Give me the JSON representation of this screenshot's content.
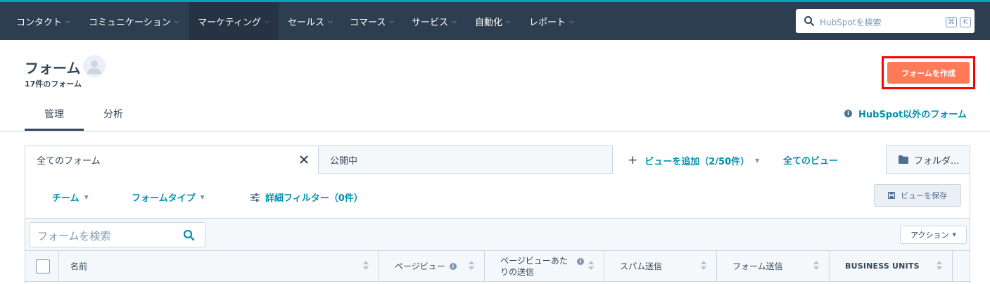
{
  "nav": {
    "items": [
      {
        "label": "コンタクト"
      },
      {
        "label": "コミュニケーション"
      },
      {
        "label": "マーケティング",
        "active": true
      },
      {
        "label": "セールス"
      },
      {
        "label": "コマース"
      },
      {
        "label": "サービス"
      },
      {
        "label": "自動化"
      },
      {
        "label": "レポート"
      }
    ],
    "search_placeholder": "HubSpotを検索",
    "shortcut_keys": [
      "⌘",
      "K"
    ]
  },
  "header": {
    "title": "フォーム",
    "subtitle": "17件のフォーム",
    "create_button": "フォームを作成",
    "highlight_color": "#ff0000",
    "accent_color": "#ff7a59"
  },
  "tabs": {
    "items": [
      {
        "label": "管理",
        "active": true
      },
      {
        "label": "分析"
      }
    ],
    "non_hubspot_link": "HubSpot以外のフォーム"
  },
  "views": {
    "tabs": [
      {
        "label": "全てのフォーム",
        "active": true,
        "closable": true
      },
      {
        "label": "公開中"
      }
    ],
    "add_view": "ビューを追加（2/50件）",
    "all_views": "全てのビュー",
    "folders": "フォルダ..."
  },
  "filters": {
    "team": "チーム",
    "form_type": "フォームタイプ",
    "advanced": "詳細フィルター（0件）",
    "save_view": "ビューを保存"
  },
  "toolbar": {
    "search_placeholder": "フォームを検索",
    "actions": "アクション"
  },
  "table": {
    "columns": [
      {
        "label": "名前"
      },
      {
        "label": "ページビュー",
        "info": true
      },
      {
        "label": "ページビューあたりの送信",
        "info": true
      },
      {
        "label": "スパム送信"
      },
      {
        "label": "フォーム送信"
      },
      {
        "label": "BUSINESS UNITS"
      }
    ]
  }
}
